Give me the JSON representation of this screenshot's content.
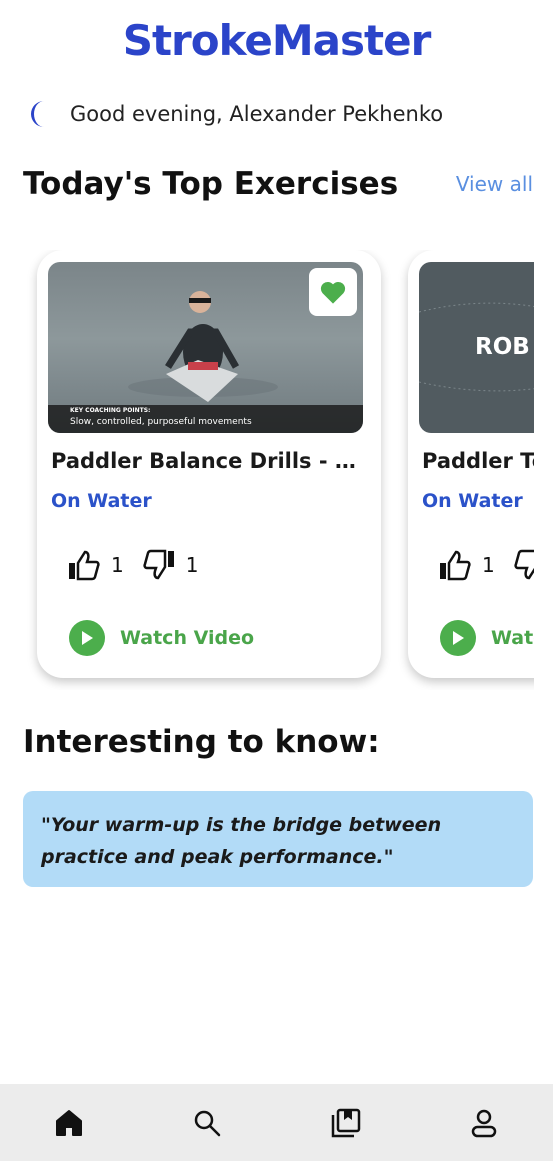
{
  "app": {
    "title": "StrokeMaster",
    "brand_color": "#2b44c9"
  },
  "greeting": {
    "icon": "moon-icon",
    "text": "Good evening, Alexander Pekhenko"
  },
  "top_exercises": {
    "title": "Today's Top Exercises",
    "view_all": "View all",
    "cards": [
      {
        "title": "Paddler Balance Drills - Ha...",
        "category": "On Water",
        "likes": "1",
        "dislikes": "1",
        "watch_label": "Watch Video",
        "favorited": true,
        "overlay_small": "KEY COACHING POINTS:",
        "overlay_text": "Slow, controlled, purposeful movements"
      },
      {
        "title": "Paddler Te",
        "category": "On Water",
        "likes": "1",
        "watch_label": "Watc",
        "thumb_text": "ROB"
      }
    ]
  },
  "interesting": {
    "title": "Interesting to know:",
    "quote": "\"Your warm-up is the bridge between practice and peak performance.\""
  },
  "nav": {
    "items": [
      "home-icon",
      "search-icon",
      "library-icon",
      "profile-icon"
    ],
    "active": "home-icon"
  },
  "colors": {
    "accent_green": "#4cae4c",
    "quote_bg": "#b2dbf7",
    "link_blue": "#5a8fe0"
  }
}
